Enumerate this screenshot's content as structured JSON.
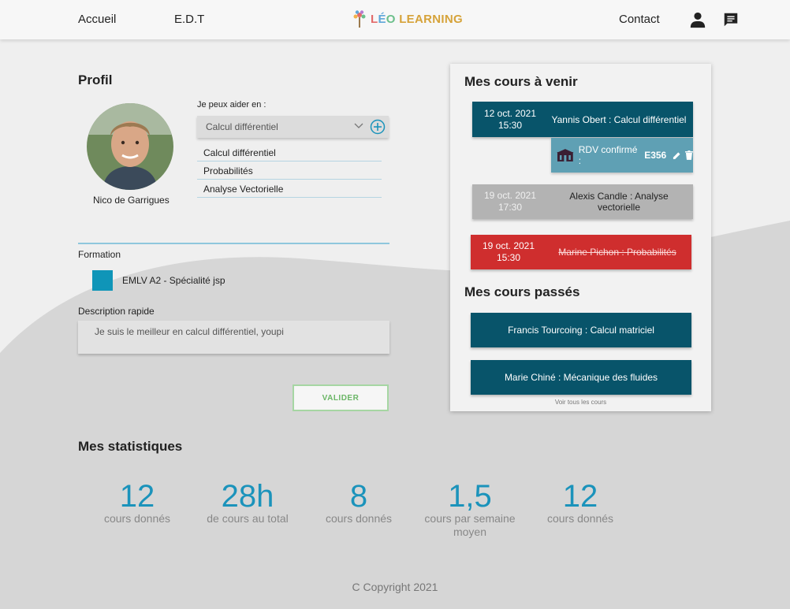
{
  "nav": {
    "home": "Accueil",
    "schedule": "E.D.T",
    "contact": "Contact",
    "logo_text": "LÉO LEARNING"
  },
  "profile": {
    "title": "Profil",
    "user_name": "Nico de Garrigues",
    "help_label": "Je peux aider en :",
    "select_value": "Calcul différentiel",
    "help_items": [
      "Calcul différentiel",
      "Probabilités",
      "Analyse Vectorielle"
    ],
    "formation_label": "Formation",
    "formation_value": "EMLV A2 - Spécialité jsp",
    "description_label": "Description rapide",
    "description_value": "Je suis le meilleur en calcul différentiel, youpi",
    "submit_label": "VALIDER"
  },
  "upcoming": {
    "title": "Mes cours à venir",
    "courses": [
      {
        "date": "12 oct. 2021",
        "time": "15:30",
        "name": "Yannis Obert : Calcul différentiel",
        "status": "confirmed"
      },
      {
        "date": "19 oct. 2021",
        "time": "17:30",
        "name": "Alexis Candle : Analyse vectorielle",
        "status": "pending"
      },
      {
        "date": "19 oct. 2021",
        "time": "15:30",
        "name": "Marine Pichon : Probabilités",
        "status": "cancelled"
      }
    ],
    "rdv_text": "RDV confirmé : ",
    "rdv_room": "E356"
  },
  "past": {
    "title": "Mes cours passés",
    "courses": [
      "Francis Tourcoing : Calcul matriciel",
      "Marie Chiné : Mécanique des fluides"
    ],
    "see_all": "Voir tous les cours"
  },
  "stats": {
    "title": "Mes statistiques",
    "items": [
      {
        "value": "12",
        "label": "cours donnés"
      },
      {
        "value": "28h",
        "label": "de cours au total"
      },
      {
        "value": "8",
        "label": "cours donnés"
      },
      {
        "value": "1,5",
        "label": "cours par semaine moyen"
      },
      {
        "value": "12",
        "label": "cours donnés"
      }
    ]
  },
  "footer": "C Copyright 2021",
  "colors": {
    "accent": "#1b93bb",
    "teal": "#08546a",
    "rdv": "#5fa0b4",
    "cancelled": "#cf2e2e",
    "pending": "#b3b3b3",
    "validate": "#6bb666"
  },
  "icons": [
    "tree-logo-icon",
    "user-icon",
    "chat-icon",
    "chevron-down-icon",
    "add-circle-icon",
    "building-icon",
    "edit-icon",
    "trash-icon"
  ]
}
